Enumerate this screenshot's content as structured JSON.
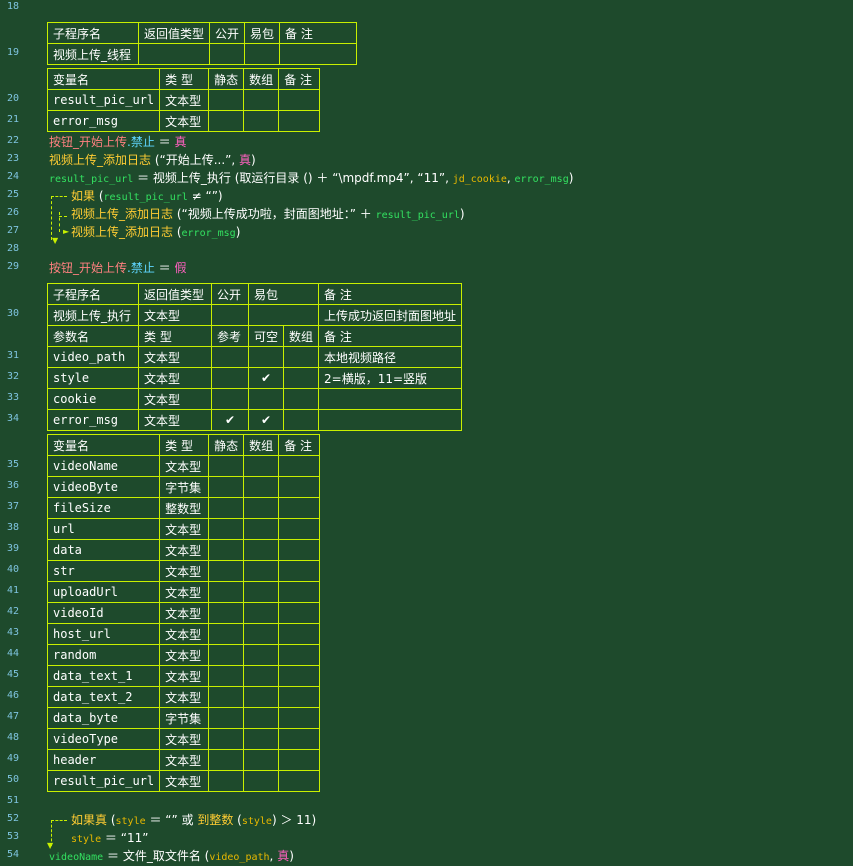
{
  "line_numbers": [
    "18",
    "19",
    "20",
    "21",
    "22",
    "23",
    "24",
    "25",
    "26",
    "27",
    "28",
    "29",
    "30",
    "31",
    "32",
    "33",
    "34",
    "35",
    "36",
    "37",
    "38",
    "39",
    "40",
    "41",
    "42",
    "43",
    "44",
    "45",
    "46",
    "47",
    "48",
    "49",
    "50",
    "51",
    "52",
    "53",
    "54"
  ],
  "sub1": {
    "headers": [
      "子程序名",
      "返回值类型",
      "公开",
      "易包",
      "备 注"
    ],
    "row": {
      "name": "视频上传_线程",
      "ret": "",
      "pub": "",
      "epkg": "",
      "note": ""
    }
  },
  "vars_headers": [
    "变量名",
    "类 型",
    "静态",
    "数组",
    "备 注"
  ],
  "vars1": [
    {
      "name": "result_pic_url",
      "type": "文本型"
    },
    {
      "name": "error_msg",
      "type": "文本型"
    }
  ],
  "code1": {
    "l22": {
      "a": "按钮_开始上传",
      "dot": ".",
      "b": "禁止",
      "eq": " ＝ ",
      "c": "真"
    },
    "l23": {
      "a": "视频上传_添加日志",
      "b": " (“开始上传...”, ",
      "c": "真",
      "d": ")"
    },
    "l24": {
      "a": "result_pic_url",
      "b": " ＝ 视频上传_执行 (取运行目录 () ＋ “\\mpdf.mp4”, “11”, ",
      "c": "jd_cookie",
      "d": ", ",
      "e": "error_msg",
      "f": ")"
    },
    "l25": {
      "a": "如果",
      "b": " (",
      "c": "result_pic_url",
      "d": " ≠ “”)"
    },
    "l26": {
      "a": "视频上传_添加日志",
      "b": " (“视频上传成功啦，封面图地址：” ＋ ",
      "c": "result_pic_url",
      "d": ")"
    },
    "l27": {
      "a": "视频上传_添加日志",
      "b": " (",
      "c": "error_msg",
      "d": ")"
    },
    "l29": {
      "a": "按钮_开始上传",
      "dot": ".",
      "b": "禁止",
      "eq": " ＝ ",
      "c": "假"
    }
  },
  "sub2": {
    "headers": [
      "子程序名",
      "返回值类型",
      "公开",
      "易包",
      "备 注"
    ],
    "row": {
      "name": "视频上传_执行",
      "ret": "文本型",
      "note": "上传成功返回封面图地址"
    },
    "param_headers": [
      "参数名",
      "类 型",
      "参考",
      "可空",
      "数组",
      "备 注"
    ],
    "params": [
      {
        "name": "video_path",
        "type": "文本型",
        "ref": "",
        "opt": "",
        "arr": "",
        "note": "本地视频路径"
      },
      {
        "name": "style",
        "type": "文本型",
        "ref": "",
        "opt": "✔",
        "arr": "",
        "note": "2=横版，11=竖版"
      },
      {
        "name": "cookie",
        "type": "文本型",
        "ref": "",
        "opt": "",
        "arr": "",
        "note": ""
      },
      {
        "name": "error_msg",
        "type": "文本型",
        "ref": "✔",
        "opt": "✔",
        "arr": "",
        "note": ""
      }
    ]
  },
  "vars2": [
    {
      "name": "videoName",
      "type": "文本型"
    },
    {
      "name": "videoByte",
      "type": "字节集"
    },
    {
      "name": "fileSize",
      "type": "整数型"
    },
    {
      "name": "url",
      "type": "文本型"
    },
    {
      "name": "data",
      "type": "文本型"
    },
    {
      "name": "str",
      "type": "文本型"
    },
    {
      "name": "uploadUrl",
      "type": "文本型"
    },
    {
      "name": "videoId",
      "type": "文本型"
    },
    {
      "name": "host_url",
      "type": "文本型"
    },
    {
      "name": "random",
      "type": "文本型"
    },
    {
      "name": "data_text_1",
      "type": "文本型"
    },
    {
      "name": "data_text_2",
      "type": "文本型"
    },
    {
      "name": "data_byte",
      "type": "字节集"
    },
    {
      "name": "videoType",
      "type": "文本型"
    },
    {
      "name": "header",
      "type": "文本型"
    },
    {
      "name": "result_pic_url",
      "type": "文本型"
    }
  ],
  "code2": {
    "l52": {
      "a": "如果真",
      "b": " (",
      "c": "style",
      "d": " ＝ “” 或 ",
      "e": "到整数",
      "f": " (",
      "g": "style",
      "h": ") ＞ 11)"
    },
    "l53": {
      "a": "style",
      "b": " ＝ “11”"
    },
    "l54": {
      "a": "videoName",
      "b": " ＝ 文件_取文件名 (",
      "c": "video_path",
      "d": ", ",
      "e": "真",
      "f": ")"
    }
  }
}
